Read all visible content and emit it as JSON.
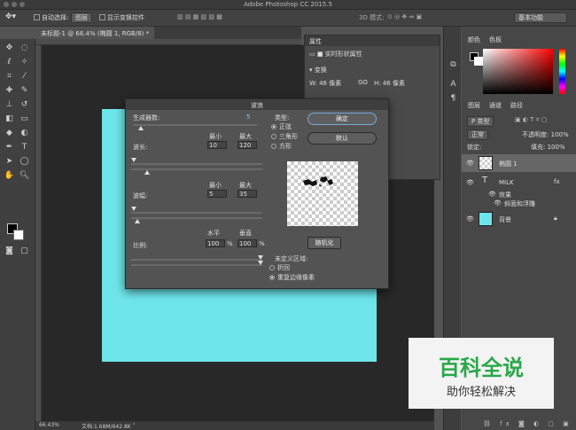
{
  "window": {
    "title": "Adobe Photoshop CC 2015.5"
  },
  "options_bar": {
    "auto_select": "自动选择:",
    "layer_select": "图层",
    "show_transform": "显示变换控件",
    "mode_3d": "3D 模式:",
    "workspace": "基本功能"
  },
  "document": {
    "tab": "未标题-1 @ 66.4% (椭圆 1, RGB/8) *",
    "zoom": "66.43%",
    "doc_size": "文档:1.68M/642.8K"
  },
  "properties": {
    "tab": "属性",
    "shape_props": "实时形状属性",
    "transform": "变换",
    "w": "W: 46 像素",
    "h": "H: 46 像素",
    "link": "GO"
  },
  "dialog": {
    "title": "波浪",
    "generators_label": "生成器数:",
    "generators_value": "5",
    "type_label": "类型:",
    "type_options": [
      "正弦",
      "三角形",
      "方形"
    ],
    "ok": "确定",
    "reset": "默认",
    "wavelength_label": "波长:",
    "amplitude_label": "波幅:",
    "min_label": "最小",
    "max_label": "最大",
    "wavelength_min": "10",
    "wavelength_max": "120",
    "amplitude_min": "5",
    "amplitude_max": "35",
    "scale_label": "比例:",
    "horizontal_label": "水平",
    "vertical_label": "垂直",
    "scale_h": "100",
    "scale_v": "100",
    "percent": "%",
    "randomize": "随机化",
    "undefined_area_label": "未定义区域:",
    "undefined_options": [
      "折回",
      "重复边缘像素"
    ]
  },
  "color_panel": {
    "tabs": [
      "颜色",
      "色板"
    ]
  },
  "layers_panel": {
    "tabs": [
      "图层",
      "通道",
      "路径"
    ],
    "filter": "P 类型",
    "blend_mode": "正常",
    "opacity": "不透明度: 100%",
    "lock": "锁定:",
    "fill": "填充: 100%",
    "layers": [
      {
        "name": "椭圆 1"
      },
      {
        "name": "MILK"
      },
      {
        "name": "效果"
      },
      {
        "name": "斜面和浮雕"
      },
      {
        "name": "背景"
      }
    ],
    "fx": "fx"
  },
  "watermark": {
    "line1": "百科全说",
    "line2": "助你轻松解决"
  },
  "colors": {
    "canvas_fill": "#6ee5ea",
    "brand_green": "#2aa84a"
  }
}
